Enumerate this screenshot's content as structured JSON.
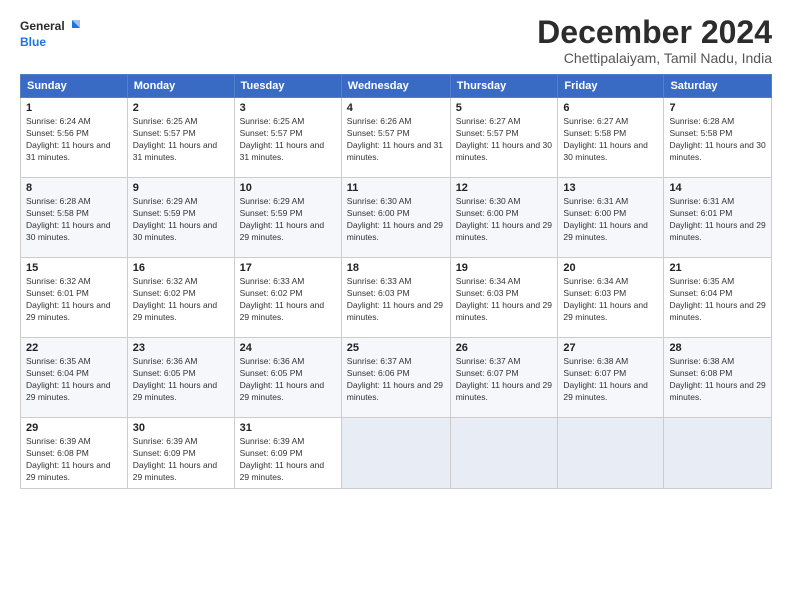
{
  "header": {
    "logo_line1": "General",
    "logo_line2": "Blue",
    "month": "December 2024",
    "location": "Chettipalaiyam, Tamil Nadu, India"
  },
  "weekdays": [
    "Sunday",
    "Monday",
    "Tuesday",
    "Wednesday",
    "Thursday",
    "Friday",
    "Saturday"
  ],
  "weeks": [
    [
      {
        "day": "1",
        "sunrise": "6:24 AM",
        "sunset": "5:56 PM",
        "daylight": "11 hours and 31 minutes."
      },
      {
        "day": "2",
        "sunrise": "6:25 AM",
        "sunset": "5:57 PM",
        "daylight": "11 hours and 31 minutes."
      },
      {
        "day": "3",
        "sunrise": "6:25 AM",
        "sunset": "5:57 PM",
        "daylight": "11 hours and 31 minutes."
      },
      {
        "day": "4",
        "sunrise": "6:26 AM",
        "sunset": "5:57 PM",
        "daylight": "11 hours and 31 minutes."
      },
      {
        "day": "5",
        "sunrise": "6:27 AM",
        "sunset": "5:57 PM",
        "daylight": "11 hours and 30 minutes."
      },
      {
        "day": "6",
        "sunrise": "6:27 AM",
        "sunset": "5:58 PM",
        "daylight": "11 hours and 30 minutes."
      },
      {
        "day": "7",
        "sunrise": "6:28 AM",
        "sunset": "5:58 PM",
        "daylight": "11 hours and 30 minutes."
      }
    ],
    [
      {
        "day": "8",
        "sunrise": "6:28 AM",
        "sunset": "5:58 PM",
        "daylight": "11 hours and 30 minutes."
      },
      {
        "day": "9",
        "sunrise": "6:29 AM",
        "sunset": "5:59 PM",
        "daylight": "11 hours and 30 minutes."
      },
      {
        "day": "10",
        "sunrise": "6:29 AM",
        "sunset": "5:59 PM",
        "daylight": "11 hours and 29 minutes."
      },
      {
        "day": "11",
        "sunrise": "6:30 AM",
        "sunset": "6:00 PM",
        "daylight": "11 hours and 29 minutes."
      },
      {
        "day": "12",
        "sunrise": "6:30 AM",
        "sunset": "6:00 PM",
        "daylight": "11 hours and 29 minutes."
      },
      {
        "day": "13",
        "sunrise": "6:31 AM",
        "sunset": "6:00 PM",
        "daylight": "11 hours and 29 minutes."
      },
      {
        "day": "14",
        "sunrise": "6:31 AM",
        "sunset": "6:01 PM",
        "daylight": "11 hours and 29 minutes."
      }
    ],
    [
      {
        "day": "15",
        "sunrise": "6:32 AM",
        "sunset": "6:01 PM",
        "daylight": "11 hours and 29 minutes."
      },
      {
        "day": "16",
        "sunrise": "6:32 AM",
        "sunset": "6:02 PM",
        "daylight": "11 hours and 29 minutes."
      },
      {
        "day": "17",
        "sunrise": "6:33 AM",
        "sunset": "6:02 PM",
        "daylight": "11 hours and 29 minutes."
      },
      {
        "day": "18",
        "sunrise": "6:33 AM",
        "sunset": "6:03 PM",
        "daylight": "11 hours and 29 minutes."
      },
      {
        "day": "19",
        "sunrise": "6:34 AM",
        "sunset": "6:03 PM",
        "daylight": "11 hours and 29 minutes."
      },
      {
        "day": "20",
        "sunrise": "6:34 AM",
        "sunset": "6:03 PM",
        "daylight": "11 hours and 29 minutes."
      },
      {
        "day": "21",
        "sunrise": "6:35 AM",
        "sunset": "6:04 PM",
        "daylight": "11 hours and 29 minutes."
      }
    ],
    [
      {
        "day": "22",
        "sunrise": "6:35 AM",
        "sunset": "6:04 PM",
        "daylight": "11 hours and 29 minutes."
      },
      {
        "day": "23",
        "sunrise": "6:36 AM",
        "sunset": "6:05 PM",
        "daylight": "11 hours and 29 minutes."
      },
      {
        "day": "24",
        "sunrise": "6:36 AM",
        "sunset": "6:05 PM",
        "daylight": "11 hours and 29 minutes."
      },
      {
        "day": "25",
        "sunrise": "6:37 AM",
        "sunset": "6:06 PM",
        "daylight": "11 hours and 29 minutes."
      },
      {
        "day": "26",
        "sunrise": "6:37 AM",
        "sunset": "6:07 PM",
        "daylight": "11 hours and 29 minutes."
      },
      {
        "day": "27",
        "sunrise": "6:38 AM",
        "sunset": "6:07 PM",
        "daylight": "11 hours and 29 minutes."
      },
      {
        "day": "28",
        "sunrise": "6:38 AM",
        "sunset": "6:08 PM",
        "daylight": "11 hours and 29 minutes."
      }
    ],
    [
      {
        "day": "29",
        "sunrise": "6:39 AM",
        "sunset": "6:08 PM",
        "daylight": "11 hours and 29 minutes."
      },
      {
        "day": "30",
        "sunrise": "6:39 AM",
        "sunset": "6:09 PM",
        "daylight": "11 hours and 29 minutes."
      },
      {
        "day": "31",
        "sunrise": "6:39 AM",
        "sunset": "6:09 PM",
        "daylight": "11 hours and 29 minutes."
      },
      null,
      null,
      null,
      null
    ]
  ]
}
